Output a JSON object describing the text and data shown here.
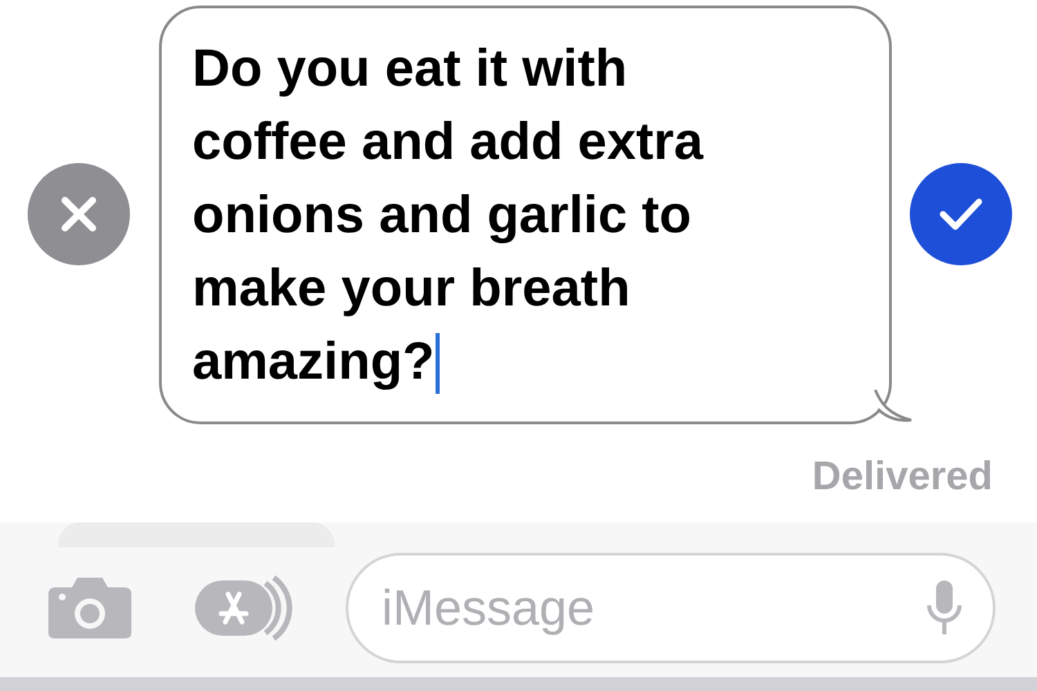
{
  "edit_bubble": {
    "value": "Do you eat it with coffee and add extra onions and garlic to make your breath amazing?"
  },
  "status": "Delivered",
  "compose": {
    "placeholder": "iMessage"
  }
}
